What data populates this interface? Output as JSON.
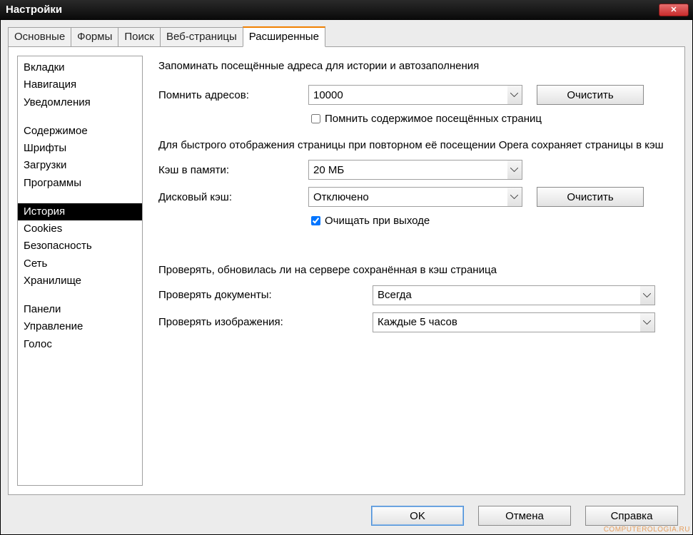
{
  "window": {
    "title": "Настройки",
    "close_icon": "✕"
  },
  "tabs": [
    {
      "label": "Основные",
      "active": false
    },
    {
      "label": "Формы",
      "active": false
    },
    {
      "label": "Поиск",
      "active": false
    },
    {
      "label": "Веб-страницы",
      "active": false
    },
    {
      "label": "Расширенные",
      "active": true
    }
  ],
  "sidebar": {
    "groups": [
      [
        "Вкладки",
        "Навигация",
        "Уведомления"
      ],
      [
        "Содержимое",
        "Шрифты",
        "Загрузки",
        "Программы"
      ],
      [
        "История",
        "Cookies",
        "Безопасность",
        "Сеть",
        "Хранилище"
      ],
      [
        "Панели",
        "Управление",
        "Голос"
      ]
    ],
    "selected": "История"
  },
  "content": {
    "heading1": "Запоминать посещённые адреса для истории и автозаполнения",
    "remember_label": "Помнить адресов:",
    "remember_value": "10000",
    "clear1_label": "Очистить",
    "remember_content_label": "Помнить содержимое посещённых страниц",
    "remember_content_checked": false,
    "cache_desc": "Для быстрого отображения страницы при повторном её посещении Opera сохраняет страницы в кэш",
    "mem_label": "Кэш в памяти:",
    "mem_value": "20 МБ",
    "disk_label": "Дисковый кэш:",
    "disk_value": "Отключено",
    "clear2_label": "Очистить",
    "clear_on_exit_label": "Очищать при выходе",
    "clear_on_exit_checked": true,
    "check_desc": "Проверять, обновилась ли на сервере сохранённая в кэш страница",
    "check_docs_label": "Проверять документы:",
    "check_docs_value": "Всегда",
    "check_imgs_label": "Проверять изображения:",
    "check_imgs_value": "Каждые 5 часов"
  },
  "buttons": {
    "ok": "OK",
    "cancel": "Отмена",
    "help": "Справка"
  },
  "watermark": "COMPUTEROLOGIA.RU"
}
